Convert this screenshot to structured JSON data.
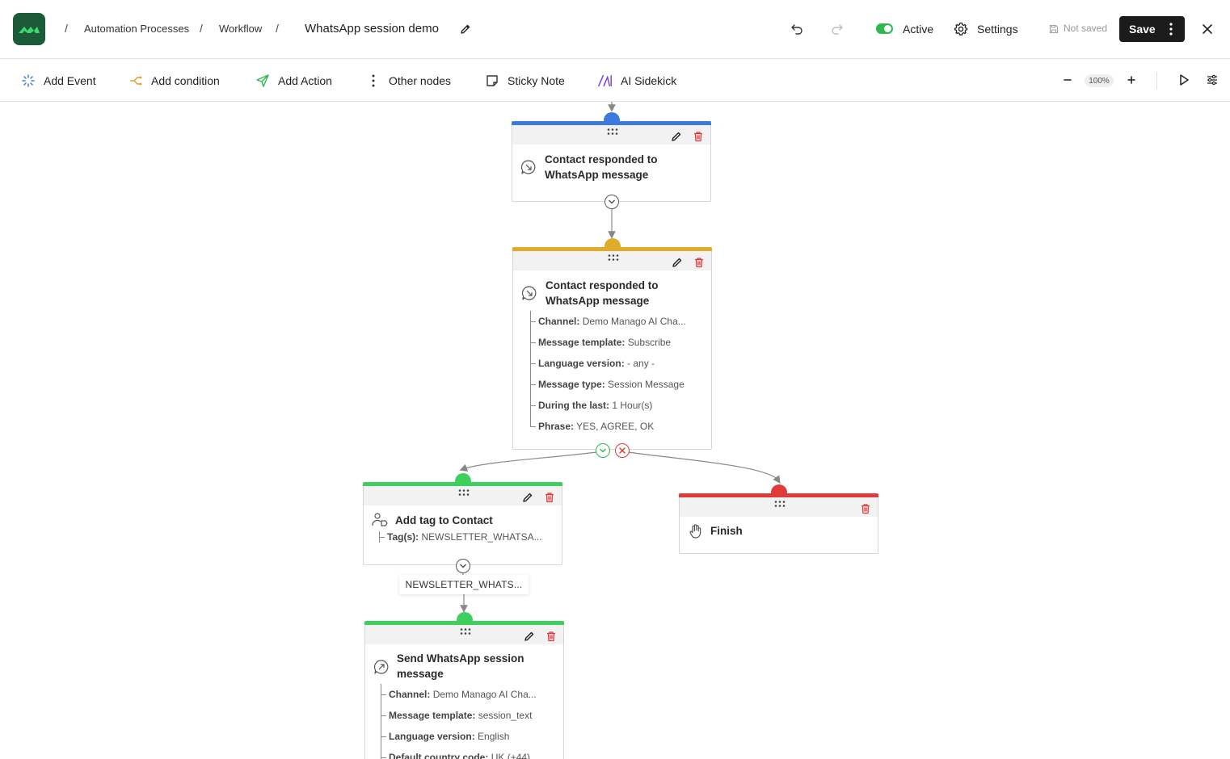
{
  "header": {
    "breadcrumbs": [
      "Automation Processes",
      "Workflow"
    ],
    "title": "WhatsApp session demo",
    "status_label": "Active",
    "settings_label": "Settings",
    "save_status": "Not saved",
    "save_label": "Save",
    "brand_color": "#1c5b3a"
  },
  "toolbar": {
    "add_event": "Add Event",
    "add_condition": "Add condition",
    "add_action": "Add Action",
    "other_nodes": "Other nodes",
    "sticky_note": "Sticky Note",
    "ai_sidekick": "AI Sidekick",
    "zoom": "100%"
  },
  "nodes": {
    "event": {
      "title_line1": "Contact responded to",
      "title_line2": "WhatsApp message",
      "color": "#3b7be0"
    },
    "condition": {
      "title_line1": "Contact responded to",
      "title_line2": "WhatsApp message",
      "color": "#e0aa2a",
      "props": [
        {
          "key": "Channel:",
          "value": "Demo Manago AI Cha..."
        },
        {
          "key": "Message template:",
          "value": "Subscribe"
        },
        {
          "key": "Language version:",
          "value": "- any -"
        },
        {
          "key": "Message type:",
          "value": "Session Message"
        },
        {
          "key": "During the last:",
          "value": "1 Hour(s)"
        },
        {
          "key": "Phrase:",
          "value": "YES, AGREE, OK"
        }
      ]
    },
    "add_tag": {
      "title": "Add tag to Contact",
      "color": "#3fcf5f",
      "props": [
        {
          "key": "Tag(s):",
          "value": "NEWSLETTER_WHATSA..."
        }
      ]
    },
    "finish": {
      "title": "Finish",
      "color": "#e03a3a"
    },
    "send_session": {
      "title_line1": "Send WhatsApp session",
      "title_line2": "message",
      "color": "#3fcf5f",
      "props": [
        {
          "key": "Channel:",
          "value": "Demo Manago AI Cha..."
        },
        {
          "key": "Message template:",
          "value": "session_text"
        },
        {
          "key": "Language version:",
          "value": "English"
        },
        {
          "key": "Default country code:",
          "value": "UK (+44)"
        }
      ]
    }
  },
  "edge_label": "NEWSLETTER_WHATS..."
}
